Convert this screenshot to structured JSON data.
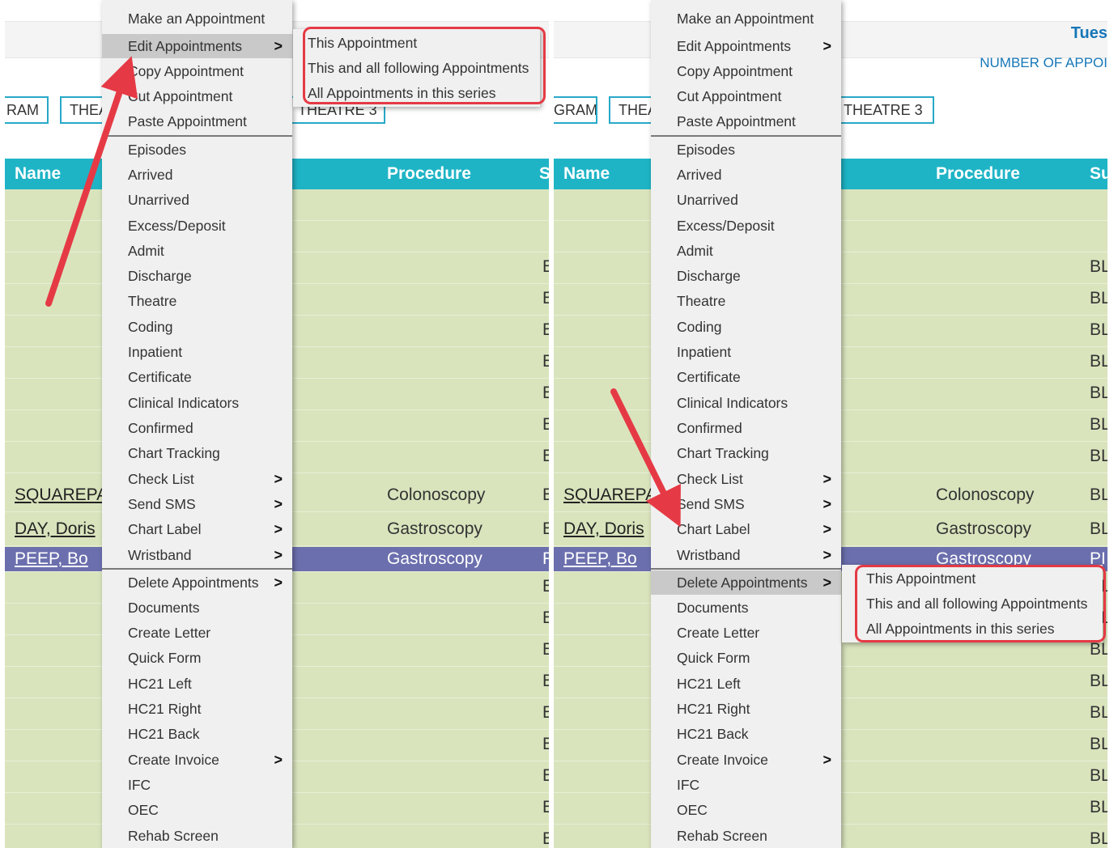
{
  "header": {
    "date_label": "Tues",
    "count_label": "NUMBER OF APPOI"
  },
  "theatre_tabs": {
    "left": [
      "RAM",
      "THEA",
      "THEATRE 3"
    ],
    "right": [
      "GRAM",
      "THEA",
      "THEATRE 3"
    ]
  },
  "columns": {
    "name": "Name",
    "procedure": "Procedure",
    "left_partial_s": "S",
    "right_partial_su": "Su"
  },
  "rows_left": [
    {
      "index": 9,
      "name": "SQUAREPA",
      "procedure": "Colonoscopy",
      "s": "E"
    },
    {
      "index": 10,
      "name": "DAY, Doris",
      "procedure": "Gastroscopy",
      "s": "E"
    },
    {
      "index": 11,
      "name": "PEEP, Bo",
      "procedure": "Gastroscopy",
      "s": "F",
      "selected": true
    }
  ],
  "rows_right": [
    {
      "index": 9,
      "name": "SQUAREPA",
      "procedure": "Colonoscopy",
      "su": "BL"
    },
    {
      "index": 10,
      "name": "DAY, Doris",
      "procedure": "Gastroscopy",
      "su": "BL"
    },
    {
      "index": 11,
      "name": "PEEP, Bo",
      "procedure": "Gastroscopy",
      "su": "PI",
      "selected": true
    }
  ],
  "fragments": {
    "left_column": [
      "E",
      "E",
      "E",
      "E",
      "E",
      "E",
      "E",
      "E",
      "E",
      "E",
      "E",
      "E",
      "E",
      "E",
      "E",
      "E"
    ],
    "right_column": [
      "BL",
      "BL",
      "BL",
      "BL",
      "BL",
      "BL",
      "BL",
      "BL",
      "BL",
      "BL",
      "BL",
      "BL",
      "BL",
      "BL",
      "BL",
      "BL",
      "BL",
      "BL"
    ]
  },
  "context_menu": {
    "make_appointment": "Make an Appointment",
    "edit_appointments": "Edit Appointments",
    "copy_appointment": "Copy Appointment",
    "cut_appointment": "Cut Appointment",
    "paste_appointment": "Paste Appointment",
    "episodes": "Episodes",
    "arrived": "Arrived",
    "unarrived": "Unarrived",
    "excess_deposit": "Excess/Deposit",
    "admit": "Admit",
    "discharge": "Discharge",
    "theatre": "Theatre",
    "coding": "Coding",
    "inpatient": "Inpatient",
    "certificate": "Certificate",
    "clinical_indicators": "Clinical Indicators",
    "confirmed": "Confirmed",
    "chart_tracking": "Chart Tracking",
    "check_list": "Check List",
    "send_sms": "Send SMS",
    "chart_label": "Chart Label",
    "wristband": "Wristband",
    "delete_appointments": "Delete Appointments",
    "documents": "Documents",
    "create_letter": "Create Letter",
    "quick_form": "Quick Form",
    "hc21_left": "HC21 Left",
    "hc21_right": "HC21 Right",
    "hc21_back": "HC21 Back",
    "create_invoice": "Create Invoice",
    "ifc": "IFC",
    "oec": "OEC",
    "rehab_screen": "Rehab Screen",
    "submenu_arrow": ">"
  },
  "submenu": {
    "this_appointment": "This Appointment",
    "this_and_following": "This and all following Appointments",
    "all_in_series": "All Appointments in this series"
  },
  "colors": {
    "grid_header": "#1eb4c6",
    "grid_body": "#d9e4bd",
    "selected_row": "#6b6fad",
    "callout": "#e53a45",
    "header_text": "#1677b8"
  }
}
